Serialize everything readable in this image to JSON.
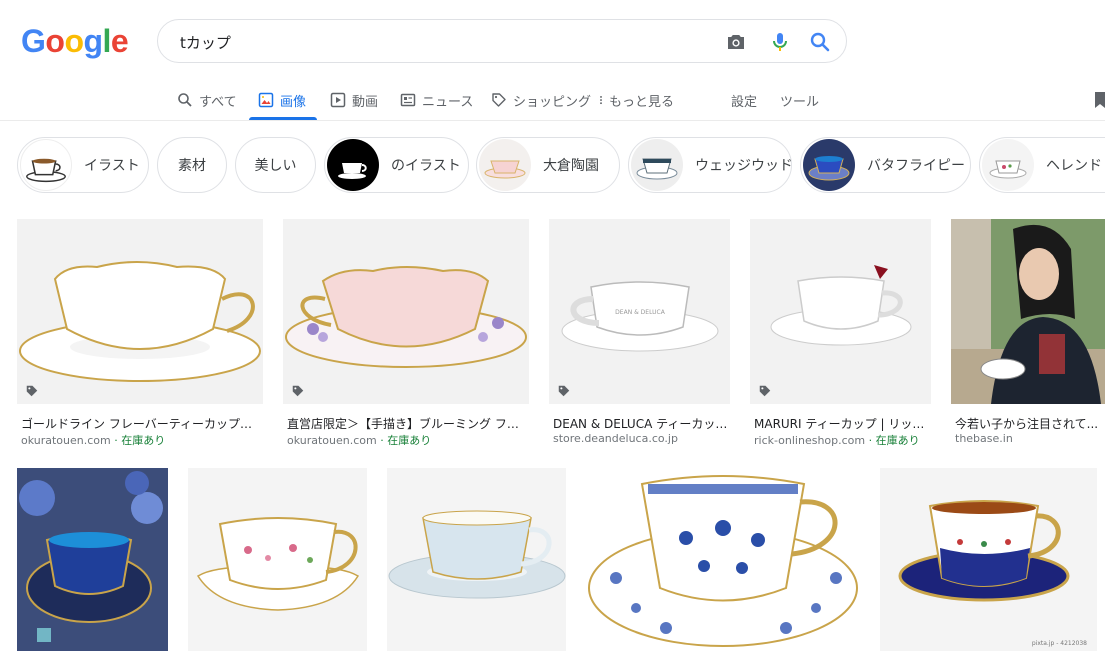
{
  "logo": {
    "letters": [
      "G",
      "o",
      "o",
      "g",
      "l",
      "e"
    ],
    "colors": [
      "#4285F4",
      "#EA4335",
      "#FBBC05",
      "#4285F4",
      "#34A853",
      "#EA4335"
    ]
  },
  "search": {
    "query": "tカップ"
  },
  "tabs": [
    {
      "label": "すべて",
      "icon": "search-icon"
    },
    {
      "label": "画像",
      "icon": "image-icon"
    },
    {
      "label": "動画",
      "icon": "video-icon"
    },
    {
      "label": "ニュース",
      "icon": "news-icon"
    },
    {
      "label": "ショッピング",
      "icon": "tag-icon"
    },
    {
      "label": "もっと見る",
      "icon": "more-icon"
    },
    {
      "label": "設定"
    },
    {
      "label": "ツール"
    }
  ],
  "chips": [
    "イラスト",
    "素材",
    "美しい",
    "のイラスト",
    "大倉陶園",
    "ウェッジウッド",
    "バタフライピー",
    "ヘレンド"
  ],
  "results_row1": [
    {
      "title": "ゴールドライン フレーバーティーカップ＆ソー...",
      "source": "okuratouen.com",
      "stock": " · 在庫あり"
    },
    {
      "title": "直営店限定＞【手描き】ブルーミング フレー...",
      "source": "okuratouen.com",
      "stock": " · 在庫あり"
    },
    {
      "title": "DEAN & DELUCA ティーカップ...",
      "source": "store.deandeluca.co.jp",
      "stock": ""
    },
    {
      "title": "MARURI ティーカップ | リックオ...",
      "source": "rick-onlineshop.com",
      "stock": " · 在庫あり"
    },
    {
      "title": "今若い子から注目されて...",
      "source": "thebase.in",
      "stock": ""
    }
  ],
  "cup_text": "DEAN & DELUCA",
  "watermark": "pixta.jp - 4212038",
  "colors": {
    "accent": "#1a73e8",
    "stock_green": "#188038",
    "gold": "#c9a44a"
  }
}
